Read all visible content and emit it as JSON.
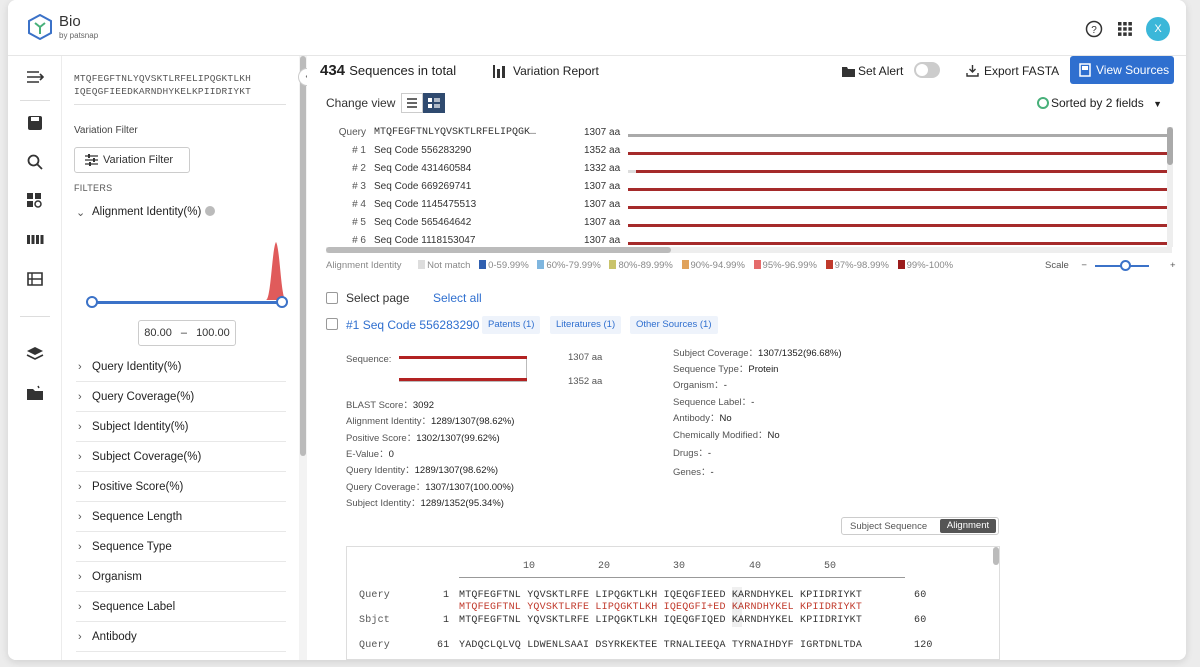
{
  "app": {
    "brand": "Bio",
    "brand_sub": "by patsnap",
    "avatar": "X"
  },
  "filters": {
    "query_seq_line1": "MTQFEGFTNLYQVSKTLRFELIPQGKTLKH",
    "query_seq_line2": "IQEQGFIEEDKARNDHYKELKPIIDRIYKT",
    "variation_filter_title": "Variation Filter",
    "variation_filter_btn": "Variation Filter",
    "filters_heading": "FILTERS",
    "alignment_identity": "Alignment Identity(%)",
    "range_min": "80.00",
    "range_sep": "–",
    "range_max": "100.00",
    "items": [
      "Query Identity(%)",
      "Query Coverage(%)",
      "Subject Identity(%)",
      "Subject Coverage(%)",
      "Positive Score(%)",
      "Sequence Length",
      "Sequence Type",
      "Organism",
      "Sequence Label",
      "Antibody"
    ]
  },
  "header": {
    "count": "434",
    "count_label": "Sequences in total",
    "variation_report": "Variation Report",
    "set_alert": "Set Alert",
    "export_fasta": "Export FASTA",
    "view_sources": "View Sources",
    "change_view": "Change view",
    "sorted": "Sorted by 2 fields"
  },
  "seqview": {
    "rows": [
      {
        "num": "Query",
        "code": "MTQFEGFTNLYQVSKTLRFELIPQGK…",
        "aa": "1307 aa"
      },
      {
        "num": "# 1",
        "code": "Seq Code 556283290",
        "aa": "1352 aa"
      },
      {
        "num": "# 2",
        "code": "Seq Code 431460584",
        "aa": "1332 aa"
      },
      {
        "num": "# 3",
        "code": "Seq Code 669269741",
        "aa": "1307 aa"
      },
      {
        "num": "# 4",
        "code": "Seq Code 1145475513",
        "aa": "1307 aa"
      },
      {
        "num": "# 5",
        "code": "Seq Code 565464642",
        "aa": "1307 aa"
      },
      {
        "num": "# 6",
        "code": "Seq Code 1118153047",
        "aa": "1307 aa"
      }
    ],
    "legend_title": "Alignment Identity",
    "legend": [
      {
        "label": "Not match",
        "color": "#dddddd"
      },
      {
        "label": "0-59.99%",
        "color": "#2f5fb0"
      },
      {
        "label": "60%-79.99%",
        "color": "#7fb6df"
      },
      {
        "label": "80%-89.99%",
        "color": "#c9c36a"
      },
      {
        "label": "90%-94.99%",
        "color": "#e0a25b"
      },
      {
        "label": "95%-96.99%",
        "color": "#e56b6b"
      },
      {
        "label": "97%-98.99%",
        "color": "#c0392b"
      },
      {
        "label": "99%-100%",
        "color": "#9b1c1c"
      }
    ],
    "scale": "Scale",
    "scale_minus": "−",
    "scale_plus": "+"
  },
  "result": {
    "select_page": "Select page",
    "select_all": "Select all",
    "title_num": "#1",
    "title_code": "Seq Code 556283290",
    "tags": [
      "Patents (1)",
      "Literatures (1)",
      "Other Sources (1)"
    ],
    "sequence_label": "Sequence:",
    "len_query": "1307 aa",
    "len_subject": "1352 aa",
    "left": [
      {
        "k": "BLAST Score：",
        "v": "3092"
      },
      {
        "k": "Alignment Identity：",
        "v": "1289/1307(98.62%)"
      },
      {
        "k": "Positive Score：",
        "v": "1302/1307(99.62%)"
      },
      {
        "k": "E-Value：",
        "v": "0"
      },
      {
        "k": "Query Identity：",
        "v": "1289/1307(98.62%)"
      },
      {
        "k": "Query Coverage：",
        "v": "1307/1307(100.00%)"
      },
      {
        "k": "Subject Identity：",
        "v": "1289/1352(95.34%)"
      }
    ],
    "right": [
      {
        "k": "Subject Coverage：",
        "v": "1307/1352(96.68%)"
      },
      {
        "k": "Sequence Type：",
        "v": "Protein"
      },
      {
        "k": "Organism：",
        "v": "-"
      },
      {
        "k": "Sequence Label：",
        "v": "-"
      },
      {
        "k": "Antibody：",
        "v": "No"
      },
      {
        "k": "Chemically Modified：",
        "v": "No"
      },
      {
        "k": "Drugs：",
        "v": "-"
      },
      {
        "k": "Genes：",
        "v": "-"
      }
    ],
    "subject_sequence": "Subject Sequence",
    "alignment": "Alignment"
  },
  "alignment": {
    "ticks": [
      "10",
      "20",
      "30",
      "40",
      "50"
    ],
    "q1_label": "Query",
    "q1_start": "1",
    "q1_seq": "MTQFEGFTNL YQVSKTLRFE LIPQGKTLKH IQEQGFIEED KARNDHYKEL KPIIDRIYKT",
    "q1_end": "60",
    "mid1": "MTQFEGFTNL YQVSKTLRFE LIPQGKTLKH IQEQGFI+ED KARNDHYKEL KPIIDRIYKT",
    "s1_label": "Sbjct",
    "s1_start": "1",
    "s1_seq": "MTQFEGFTNL YQVSKTLRFE LIPQGKTLKH IQEQGFIQED KARNDHYKEL KPIIDRIYKT",
    "s1_end": "60",
    "q2_label": "Query",
    "q2_start": "61",
    "q2_seq": "YADQCLQLVQ LDWENLSAAI DSYRKEKTEE TRNALIEEQA TYRNAIHDYF IGRTDNLTDA",
    "q2_end": "120"
  }
}
